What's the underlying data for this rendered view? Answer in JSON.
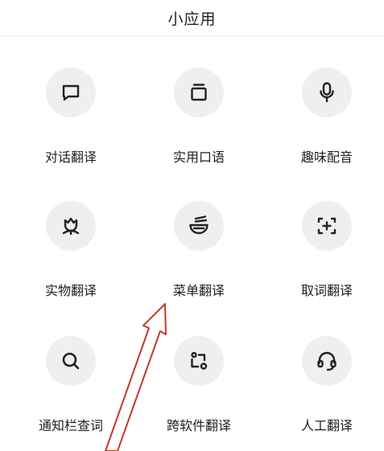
{
  "header": {
    "title": "小应用"
  },
  "apps": [
    {
      "label": "对话翻译",
      "icon": "chat-bubble-icon"
    },
    {
      "label": "实用口语",
      "icon": "cards-stack-icon"
    },
    {
      "label": "趣味配音",
      "icon": "microphone-icon"
    },
    {
      "label": "实物翻译",
      "icon": "flower-icon"
    },
    {
      "label": "菜单翻译",
      "icon": "noodle-bowl-icon"
    },
    {
      "label": "取词翻译",
      "icon": "scan-add-icon"
    },
    {
      "label": "通知栏查词",
      "icon": "search-icon"
    },
    {
      "label": "跨软件翻译",
      "icon": "cross-app-icon"
    },
    {
      "label": "人工翻译",
      "icon": "headset-icon"
    }
  ],
  "colors": {
    "icon_bg": "#efefef",
    "icon_stroke": "#222222",
    "annotation_arrow": "#c0392b"
  }
}
